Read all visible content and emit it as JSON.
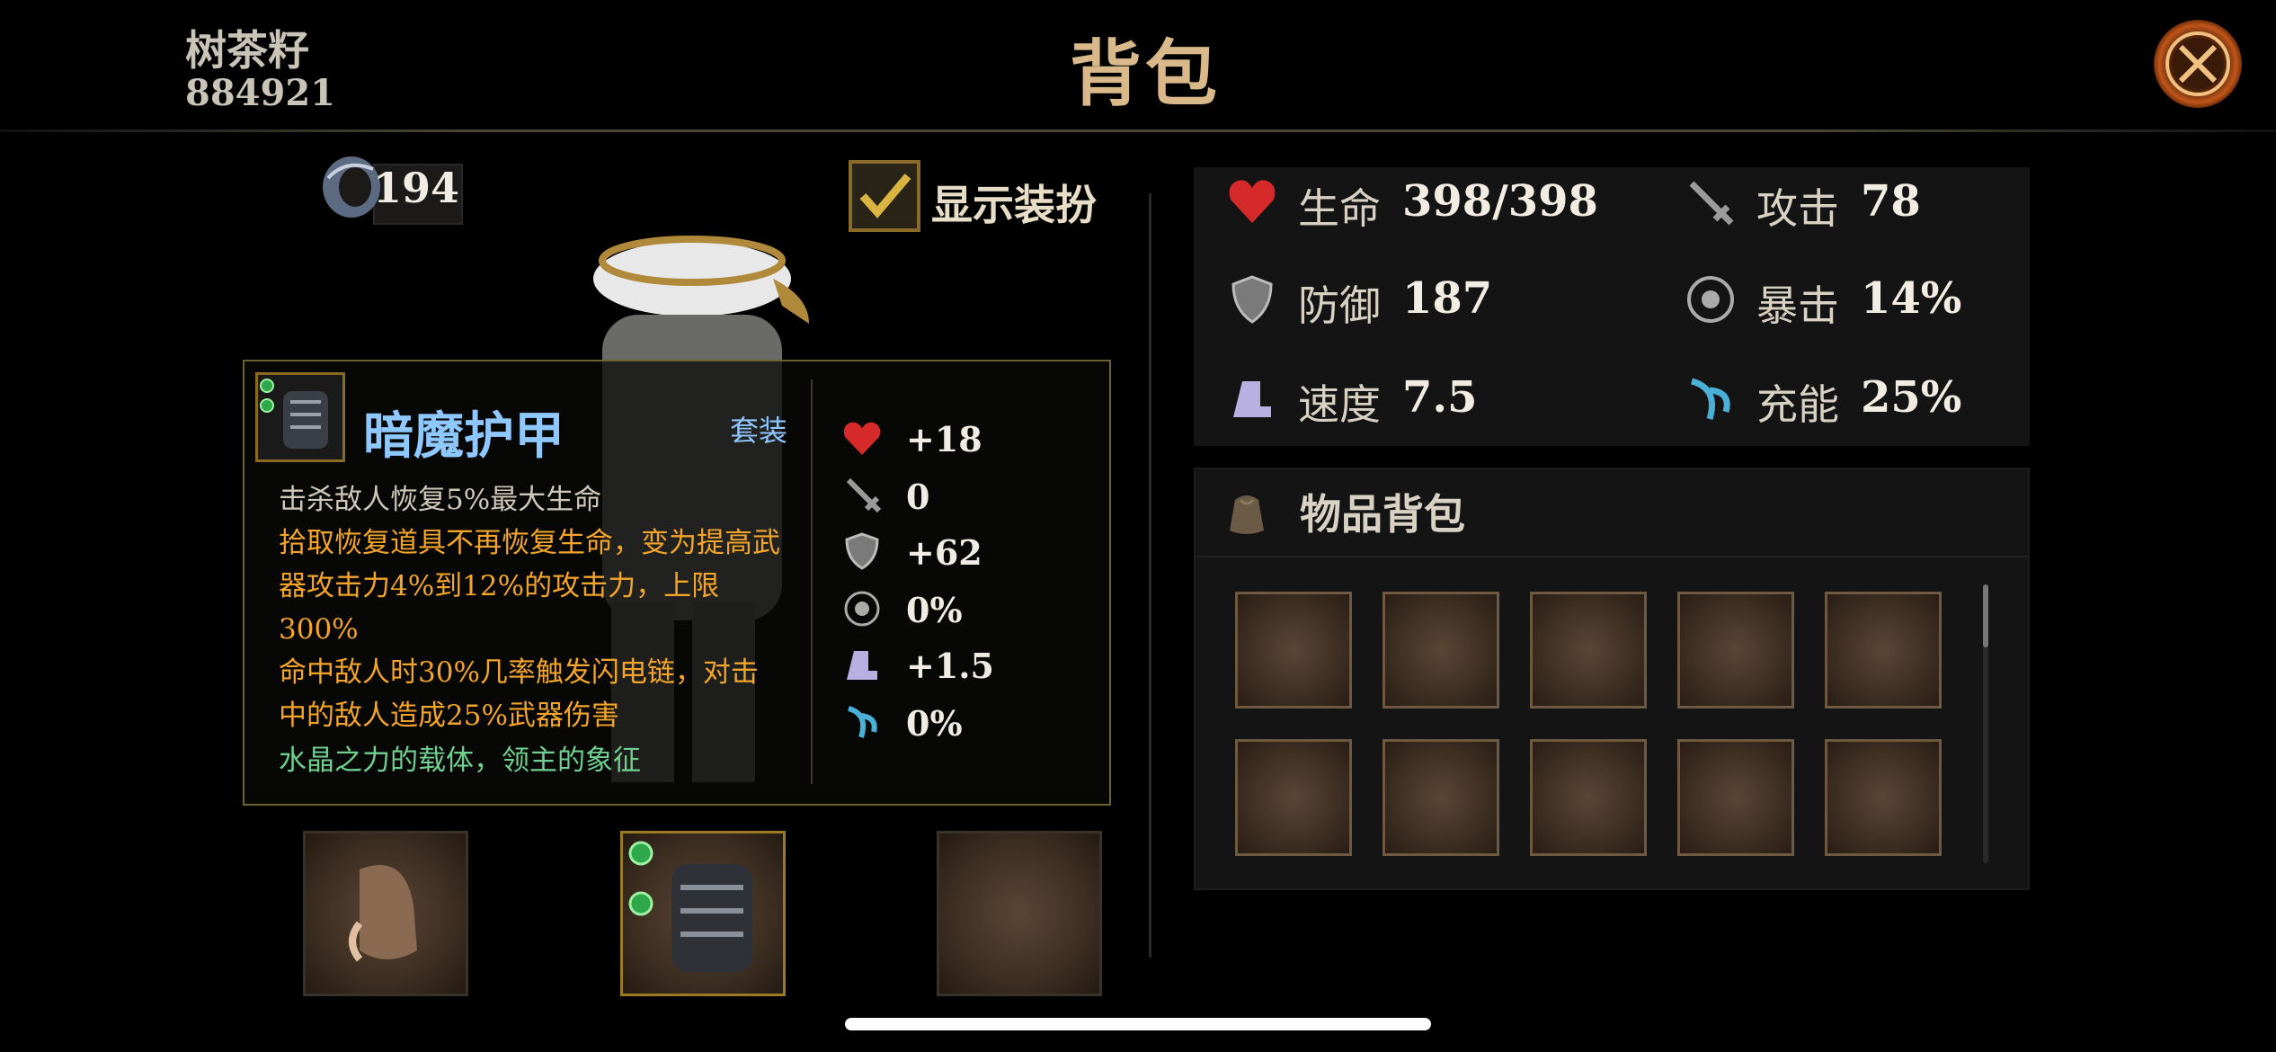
{
  "header": {
    "player_name": "树茶籽",
    "player_id": "884921",
    "title": "背包"
  },
  "currency": {
    "value": "194"
  },
  "outfit": {
    "label": "显示装扮",
    "checked": true
  },
  "item_detail": {
    "name": "暗魔护甲",
    "tag": "套装",
    "descriptions": [
      "击杀敌人恢复5%最大生命",
      "拾取恢复道具不再恢复生命，变为提高武器攻击力4%到12%的攻击力，上限300%",
      "命中敌人时30%几率触发闪电链，对击中的敌人造成25%武器伤害",
      "水晶之力的载体，领主的象征"
    ],
    "stats": [
      {
        "icon": "heart-icon",
        "value": "+18"
      },
      {
        "icon": "sword-icon",
        "value": "0"
      },
      {
        "icon": "shield-icon",
        "value": "+62"
      },
      {
        "icon": "crit-icon",
        "value": "0%"
      },
      {
        "icon": "boot-icon",
        "value": "+1.5"
      },
      {
        "icon": "energy-icon",
        "value": "0%"
      }
    ]
  },
  "stats": {
    "hp": {
      "label": "生命",
      "value": "398/398"
    },
    "attack": {
      "label": "攻击",
      "value": "78"
    },
    "defense": {
      "label": "防御",
      "value": "187"
    },
    "crit": {
      "label": "暴击",
      "value": "14%"
    },
    "speed": {
      "label": "速度",
      "value": "7.5"
    },
    "charge": {
      "label": "充能",
      "value": "25%"
    }
  },
  "inventory": {
    "title": "物品背包"
  },
  "colors": {
    "accent_gold": "#d9b98a",
    "item_name_blue": "#8fc7ff",
    "effect_orange": "#f2a52a",
    "flavor_green": "#70d090"
  }
}
